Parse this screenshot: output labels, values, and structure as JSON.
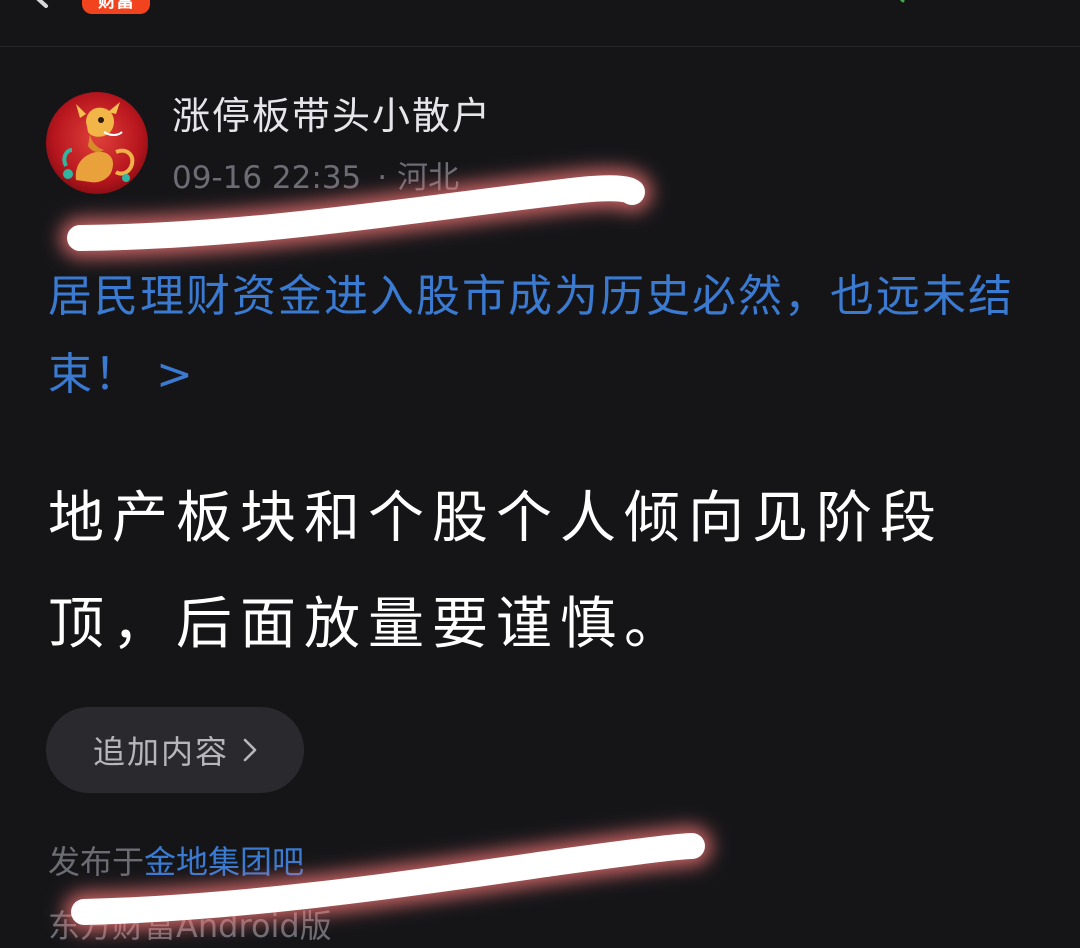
{
  "header": {
    "brand_badge": "财富"
  },
  "post": {
    "author": "涨停板带头小散户",
    "time": "09-16 22:35",
    "separator": "·",
    "location": "河北",
    "link_title": "居民理财资金进入股市成为历史必然，也远未结束！ >",
    "body": "地产板块和个股个人倾向见阶段顶，后面放量要谨慎。",
    "add_content_label": "追加内容",
    "published_prefix": "发布于",
    "forum": "金地集团吧",
    "client": "东方财富Android版"
  },
  "colors": {
    "background": "#151518",
    "link_blue": "#3b7ad1",
    "brand_orange": "#f0431e",
    "muted_text": "#6c6c74"
  }
}
